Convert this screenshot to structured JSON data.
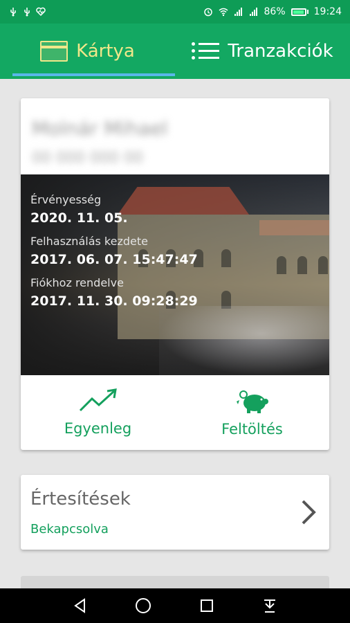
{
  "status_bar": {
    "battery": "86%",
    "time": "19:24",
    "battery_level": 0.86
  },
  "tabs": [
    {
      "label": "Kártya",
      "icon": "card-icon",
      "active": true
    },
    {
      "label": "Tranzakciók",
      "icon": "list-icon",
      "active": false
    }
  ],
  "card": {
    "owner_name": "Molnár Mihael",
    "card_number": "00 000 000 00",
    "validity_label": "Érvényesség",
    "validity_value": "2020. 11. 05.",
    "usage_start_label": "Felhasználás kezdete",
    "usage_start_value": "2017. 06. 07. 15:47:47",
    "assigned_label": "Fiókhoz rendelve",
    "assigned_value": "2017. 11. 30. 09:28:29",
    "actions": [
      {
        "label": "Egyenleg",
        "icon": "trend-up-icon"
      },
      {
        "label": "Feltöltés",
        "icon": "piggy-bank-icon"
      }
    ]
  },
  "notifications": {
    "title": "Értesítések",
    "status": "Bekapcsolva"
  },
  "colors": {
    "primary": "#13a862",
    "status_bar": "#0e9c56",
    "accent_text": "#f0e78a",
    "tab_indicator": "#5ab7ea",
    "green_text": "#14a05d"
  }
}
